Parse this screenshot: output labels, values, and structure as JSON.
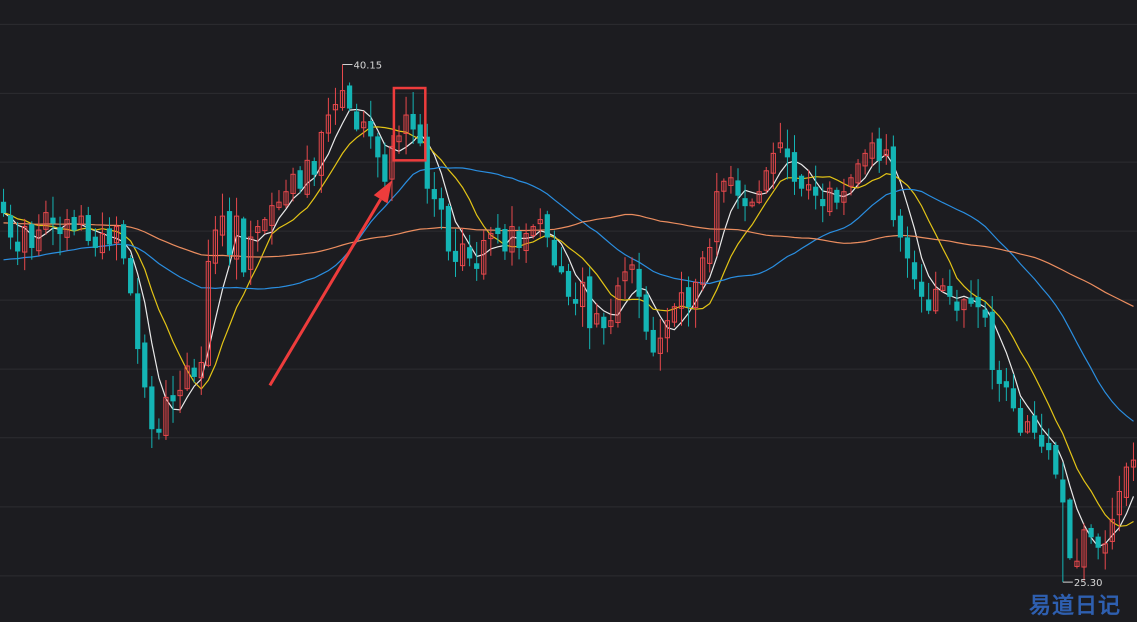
{
  "chart_data": {
    "type": "candlestick",
    "ylim": [
      24.5,
      42
    ],
    "grid": true,
    "gridlines": [
      41.3,
      39.32,
      37.35,
      35.37,
      33.39,
      31.41,
      29.44,
      27.46,
      25.48
    ],
    "colors": {
      "up": "#e8484c",
      "down": "#14b4b4",
      "gridline": "#2c2c31",
      "ma5": "#e9e9e9",
      "ma10": "#e3c416",
      "ma30": "#2a8ee0",
      "ma60": "#eb8d5f",
      "arrow": "#ee3c3c",
      "highlight": "#ee3c3c"
    },
    "extremes": {
      "high": {
        "label": "40.15",
        "index": 48,
        "value": 40.15
      },
      "low": {
        "label": "25.30",
        "index": 150,
        "value": 25.3
      }
    },
    "highlight_range": [
      56,
      59
    ],
    "moving_averages": [
      {
        "key": "ma5",
        "period": 5
      },
      {
        "key": "ma10",
        "period": 10
      },
      {
        "key": "ma30",
        "period": 30,
        "seed": 34.5
      },
      {
        "key": "ma60",
        "period": 60,
        "seed": 35.6
      }
    ],
    "close": [
      35.9,
      35.2,
      34.8,
      35.5,
      34.9,
      35.4,
      35.9,
      35.6,
      35.3,
      35.7,
      35.4,
      35.8,
      35.1,
      34.9,
      35.3,
      35.0,
      35.5,
      34.6,
      33.6,
      32.0,
      30.9,
      29.7,
      29.6,
      30.6,
      30.5,
      30.8,
      31.5,
      31.2,
      31.6,
      34.5,
      35.4,
      35.8,
      34.7,
      35.8,
      34.2,
      35.2,
      35.5,
      35.7,
      36.1,
      36.2,
      36.5,
      37.0,
      36.6,
      37.4,
      37.0,
      38.2,
      38.7,
      39.0,
      39.4,
      38.9,
      38.3,
      38.5,
      38.1,
      37.5,
      36.8,
      37.8,
      38.1,
      38.7,
      38.3,
      37.9,
      36.6,
      36.3,
      36.0,
      34.8,
      34.5,
      35.0,
      34.6,
      34.3,
      35.1,
      35.3,
      35.3,
      34.8,
      35.5,
      34.9,
      35.3,
      35.5,
      35.7,
      35.2,
      34.4,
      34.2,
      33.5,
      33.3,
      33.9,
      32.6,
      33.0,
      32.6,
      32.8,
      33.8,
      34.2,
      34.4,
      33.5,
      32.5,
      31.9,
      32.3,
      32.8,
      33.2,
      33.6,
      33.2,
      33.9,
      34.6,
      34.9,
      36.5,
      36.8,
      36.9,
      36.4,
      36.1,
      36.2,
      36.5,
      37.1,
      37.6,
      37.9,
      37.5,
      36.8,
      36.6,
      36.7,
      36.4,
      36.1,
      36.6,
      36.2,
      36.5,
      36.9,
      37.3,
      37.6,
      37.9,
      37.4,
      37.7,
      35.7,
      35.2,
      34.6,
      34.0,
      33.5,
      33.1,
      33.7,
      33.8,
      33.5,
      33.1,
      33.4,
      33.3,
      33.2,
      32.9,
      31.4,
      31.0,
      30.9,
      30.3,
      29.6,
      29.9,
      29.6,
      29.2,
      29.1,
      28.4,
      27.6,
      26.0,
      25.9,
      26.8,
      26.6,
      26.3,
      26.4,
      27.1,
      27.9,
      28.6,
      28.8
    ]
  },
  "watermark": "易道日记"
}
